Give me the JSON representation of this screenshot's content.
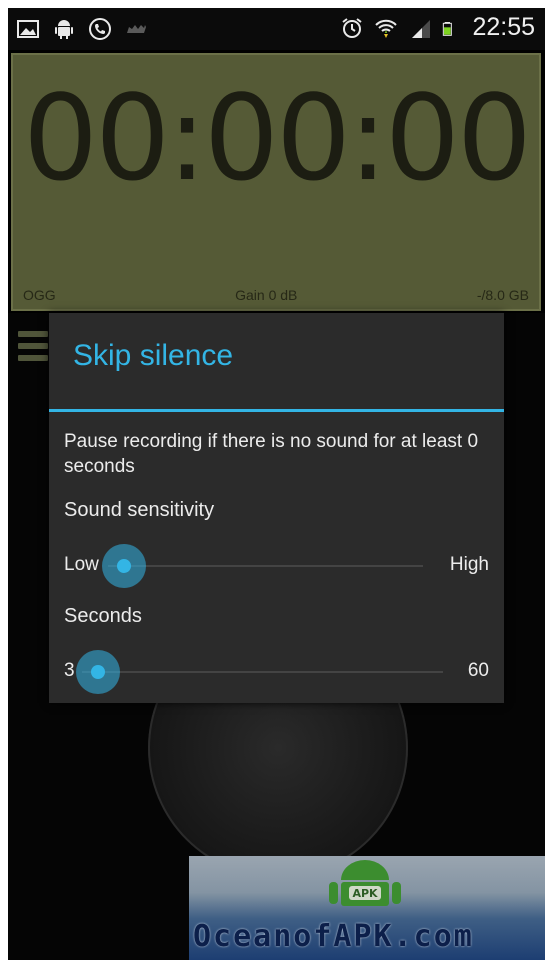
{
  "status_bar": {
    "time": "22:55",
    "left_icons": [
      "image-icon",
      "android-icon",
      "phone-icon",
      "camel-icon"
    ],
    "right_icons": [
      "alarm-clock-icon",
      "wifi-icon",
      "signal-icon",
      "battery-icon"
    ],
    "colors": {
      "icon": "#e9e9e9",
      "battery": "#7ed321"
    }
  },
  "recorder": {
    "timer": "00:00:00",
    "format": "OGG",
    "gain": "Gain 0 dB",
    "storage": "-/8.0 GB"
  },
  "dialog": {
    "title": "Skip silence",
    "message": "Pause recording if there is no sound for at least 0 seconds",
    "sensitivity": {
      "label": "Sound sensitivity",
      "min_label": "Low",
      "max_label": "High",
      "value": 0.0
    },
    "seconds": {
      "label": "Seconds",
      "min_label": "3",
      "max_label": "60",
      "value": 0.0
    },
    "accent_color": "#33b5e5"
  },
  "watermark": {
    "text": "OceanofAPK.com",
    "badge": "APK"
  }
}
